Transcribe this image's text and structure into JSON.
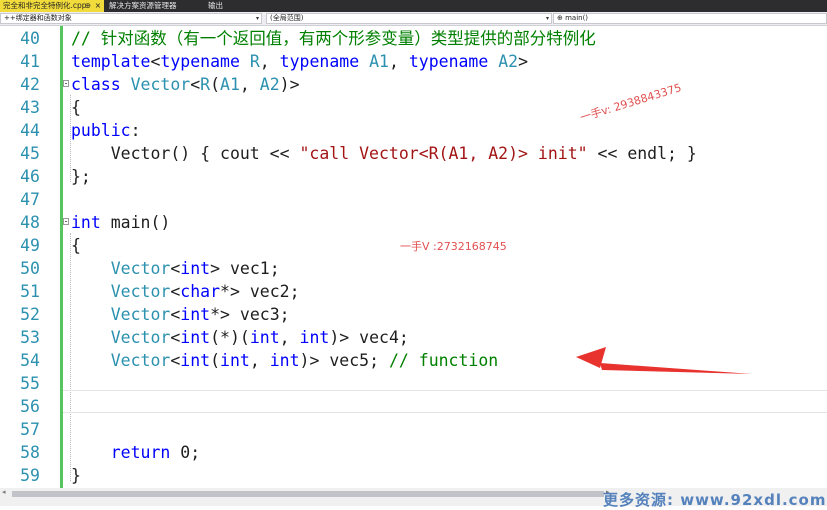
{
  "tabs": [
    {
      "label": "完全和非完全特例化.cpp",
      "pin": "⊕",
      "close": "×"
    },
    {
      "label": "解决方案资源管理器"
    },
    {
      "label": "输出"
    }
  ],
  "navbar": {
    "scope_left": "++绑定器和函数对象",
    "scope_mid": "(全局范围)",
    "scope_right": "⊕ main()",
    "dropdown_glyph": "▾"
  },
  "editor": {
    "line_numbers": [
      "40",
      "41",
      "42",
      "43",
      "44",
      "45",
      "46",
      "47",
      "48",
      "49",
      "50",
      "51",
      "52",
      "53",
      "54",
      "55",
      "56",
      "57",
      "58",
      "59"
    ],
    "code_lines": [
      [
        {
          "t": "// 针对函数（有一个返回值，有两个形参变量）类型提供的部分特例化",
          "c": "cm"
        }
      ],
      [
        {
          "t": "template",
          "c": "kw"
        },
        {
          "t": "<",
          "c": "nu"
        },
        {
          "t": "typename",
          "c": "kw"
        },
        {
          "t": " ",
          "c": "nu"
        },
        {
          "t": "R",
          "c": "ty"
        },
        {
          "t": ", ",
          "c": "nu"
        },
        {
          "t": "typename",
          "c": "kw"
        },
        {
          "t": " ",
          "c": "nu"
        },
        {
          "t": "A1",
          "c": "ty"
        },
        {
          "t": ", ",
          "c": "nu"
        },
        {
          "t": "typename",
          "c": "kw"
        },
        {
          "t": " ",
          "c": "nu"
        },
        {
          "t": "A2",
          "c": "ty"
        },
        {
          "t": ">",
          "c": "nu"
        }
      ],
      [
        {
          "t": "class",
          "c": "kw"
        },
        {
          "t": " ",
          "c": "nu"
        },
        {
          "t": "Vector",
          "c": "ty"
        },
        {
          "t": "<",
          "c": "nu"
        },
        {
          "t": "R",
          "c": "ty"
        },
        {
          "t": "(",
          "c": "nu"
        },
        {
          "t": "A1",
          "c": "ty"
        },
        {
          "t": ", ",
          "c": "nu"
        },
        {
          "t": "A2",
          "c": "ty"
        },
        {
          "t": ")>",
          "c": "nu"
        }
      ],
      [
        {
          "t": "{",
          "c": "nu"
        }
      ],
      [
        {
          "t": "public",
          "c": "kw"
        },
        {
          "t": ":",
          "c": "nu"
        }
      ],
      [
        {
          "t": "    Vector() { cout << ",
          "c": "nu"
        },
        {
          "t": "\"call Vector<R(A1, A2)> init\"",
          "c": "st"
        },
        {
          "t": " << endl; }",
          "c": "nu"
        }
      ],
      [
        {
          "t": "};",
          "c": "nu"
        }
      ],
      [],
      [
        {
          "t": "int",
          "c": "kw"
        },
        {
          "t": " main()",
          "c": "nu"
        }
      ],
      [
        {
          "t": "{",
          "c": "nu"
        }
      ],
      [
        {
          "t": "    ",
          "c": "nu"
        },
        {
          "t": "Vector",
          "c": "ty"
        },
        {
          "t": "<",
          "c": "nu"
        },
        {
          "t": "int",
          "c": "kw"
        },
        {
          "t": "> vec1;",
          "c": "nu"
        }
      ],
      [
        {
          "t": "    ",
          "c": "nu"
        },
        {
          "t": "Vector",
          "c": "ty"
        },
        {
          "t": "<",
          "c": "nu"
        },
        {
          "t": "char",
          "c": "kw"
        },
        {
          "t": "*> vec2;",
          "c": "nu"
        }
      ],
      [
        {
          "t": "    ",
          "c": "nu"
        },
        {
          "t": "Vector",
          "c": "ty"
        },
        {
          "t": "<",
          "c": "nu"
        },
        {
          "t": "int",
          "c": "kw"
        },
        {
          "t": "*> vec3;",
          "c": "nu"
        }
      ],
      [
        {
          "t": "    ",
          "c": "nu"
        },
        {
          "t": "Vector",
          "c": "ty"
        },
        {
          "t": "<",
          "c": "nu"
        },
        {
          "t": "int",
          "c": "kw"
        },
        {
          "t": "(*)(",
          "c": "nu"
        },
        {
          "t": "int",
          "c": "kw"
        },
        {
          "t": ", ",
          "c": "nu"
        },
        {
          "t": "int",
          "c": "kw"
        },
        {
          "t": ")> vec4;",
          "c": "nu"
        }
      ],
      [
        {
          "t": "    ",
          "c": "nu"
        },
        {
          "t": "Vector",
          "c": "ty"
        },
        {
          "t": "<",
          "c": "nu"
        },
        {
          "t": "int",
          "c": "kw"
        },
        {
          "t": "(",
          "c": "nu"
        },
        {
          "t": "int",
          "c": "kw"
        },
        {
          "t": ", ",
          "c": "nu"
        },
        {
          "t": "int",
          "c": "kw"
        },
        {
          "t": ")> vec5; ",
          "c": "nu"
        },
        {
          "t": "// function",
          "c": "cm"
        }
      ],
      [],
      [],
      [],
      [
        {
          "t": "    ",
          "c": "nu"
        },
        {
          "t": "return",
          "c": "kw"
        },
        {
          "t": " 0;",
          "c": "nu"
        }
      ],
      [
        {
          "t": "}",
          "c": "nu"
        }
      ]
    ]
  },
  "watermarks": {
    "w1": "一手v: 2938843375",
    "w2": "一手V :2732168745",
    "promo": "更多资源: www.92xdl.com"
  },
  "scrollbar": {
    "left_arrow": "◂",
    "right_arrow": "▸"
  },
  "colors": {
    "keyword": "#0000ff",
    "type": "#2b91af",
    "string": "#a31515",
    "comment": "#008000",
    "arrow": "#e8322e",
    "active_tab": "#f2dc3c"
  }
}
